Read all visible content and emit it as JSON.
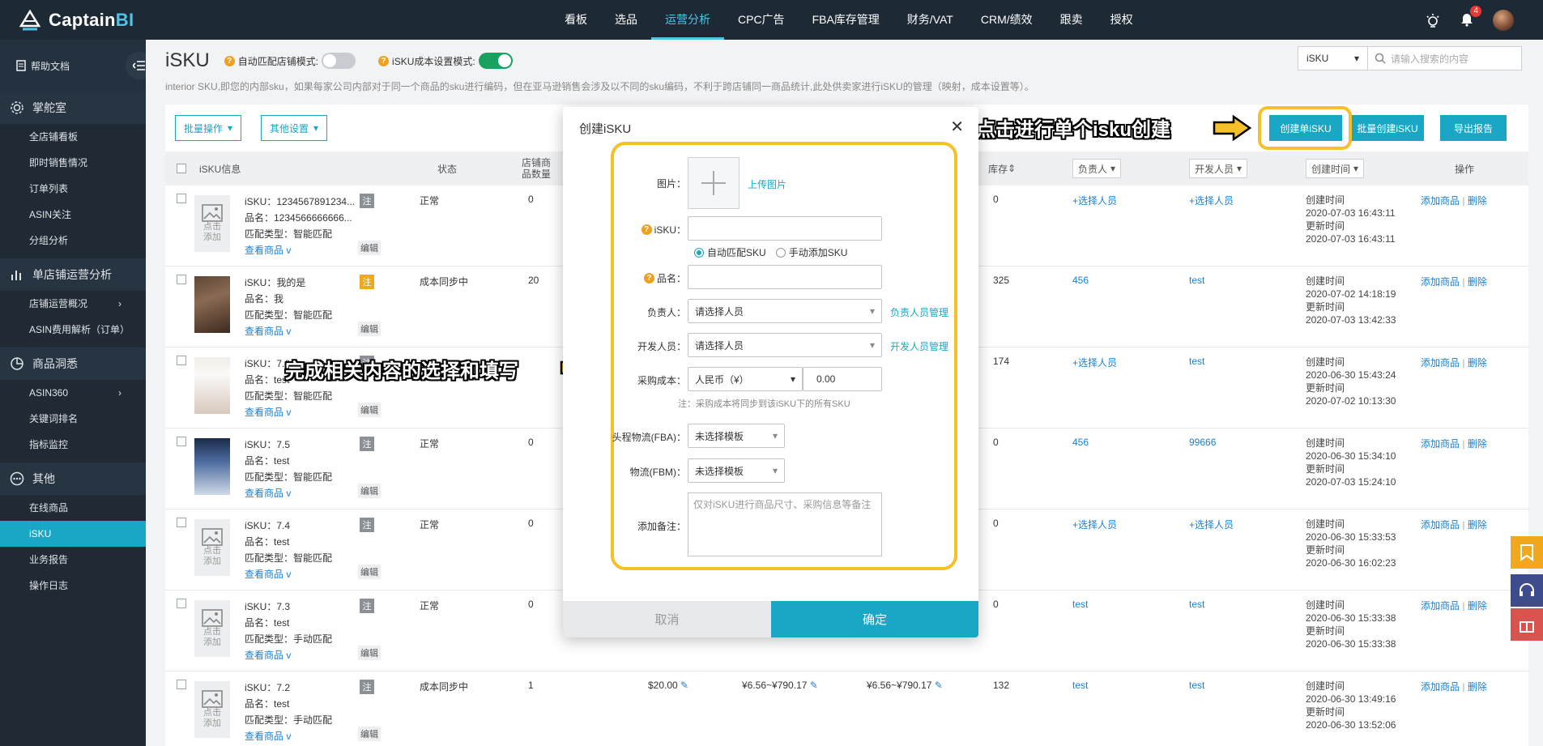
{
  "app": {
    "logo_main": "Captain",
    "logo_accent": "BI"
  },
  "nav": [
    "看板",
    "选品",
    "运营分析",
    "CPC广告",
    "FBA库存管理",
    "财务/VAT",
    "CRM/绩效",
    "跟卖",
    "授权"
  ],
  "nav_active": "运营分析",
  "notifications": "4",
  "sidebar": {
    "help": "帮助文档",
    "sections": [
      {
        "title": "掌舵室",
        "icon": "gear-icon",
        "items": [
          "全店铺看板",
          "即时销售情况",
          "订单列表",
          "ASIN关注",
          "分组分析"
        ]
      },
      {
        "title": "单店铺运营分析",
        "icon": "bar-chart-icon",
        "items": [
          "店铺运营概况",
          "ASIN费用解析（订单）"
        ]
      },
      {
        "title": "商品洞悉",
        "icon": "pie-icon",
        "items": [
          "ASIN360",
          "关键词排名",
          "指标监控"
        ]
      },
      {
        "title": "其他",
        "icon": "more-icon",
        "items": [
          "在线商品",
          "iSKU",
          "业务报告",
          "操作日志"
        ]
      }
    ],
    "active_item": "iSKU"
  },
  "page": {
    "title": "iSKU",
    "mode1_label": "自动匹配店铺模式:",
    "mode2_label": "iSKU成本设置模式:",
    "description": "interior SKU,即您的内部sku，如果每家公司内部对于同一个商品的sku进行编码，但在亚马逊销售会涉及以不同的sku编码，不利于跨店铺同一商品统计,此处供卖家进行iSKU的管理（映射，成本设置等）。",
    "search_select": "iSKU",
    "search_placeholder": "请输入搜索的内容"
  },
  "toolbar": {
    "batch_ops": "批量操作",
    "other_settings": "其他设置",
    "create_single": "创建单iSKU",
    "create_batch": "批量创建iSKU",
    "export": "导出报告"
  },
  "table_headers": {
    "info": "iSKU信息",
    "status": "状态",
    "shop_count_1": "店铺商",
    "shop_count_2": "品数量",
    "stock": "库存",
    "owner": "负责人",
    "developer": "开发人员",
    "created": "创建时间",
    "action": "操作"
  },
  "rows": [
    {
      "isku": "iSKU：1234567891234...",
      "name": "品名：1234566666666...",
      "match": "匹配类型：智能匹配",
      "view": "查看商品 v",
      "tag": "注",
      "status": "正常",
      "count": "0",
      "price": "",
      "cost1": "",
      "cost2": "",
      "stock": "0",
      "owner": "+选择人员",
      "dev": "+选择人员",
      "created_label": "创建时间",
      "created": "2020-07-03 16:43:11",
      "updated_label": "更新时间",
      "updated": "2020-07-03 16:43:11",
      "placeholder": "点击添加",
      "edit": "编辑"
    },
    {
      "isku": "iSKU：我的是",
      "name": "品名：我",
      "match": "匹配类型：智能匹配",
      "view": "查看商品 v",
      "tag": "注",
      "status": "成本同步中",
      "count": "20",
      "price": "",
      "cost1": "",
      "cost2": "",
      "stock": "325",
      "owner": "456",
      "dev": "test",
      "created_label": "创建时间",
      "created": "2020-07-02 14:18:19",
      "updated_label": "更新时间",
      "updated": "2020-07-03 13:42:33",
      "placeholder": "",
      "edit": "编辑"
    },
    {
      "isku": "iSKU：7.6",
      "name": "品名：test",
      "match": "匹配类型：智能匹配",
      "view": "查看商品 v",
      "tag": "注",
      "status": "",
      "count": "",
      "price": "",
      "cost1": "",
      "cost2": "",
      "stock": "174",
      "owner": "+选择人员",
      "dev": "test",
      "created_label": "创建时间",
      "created": "2020-06-30 15:43:24",
      "updated_label": "更新时间",
      "updated": "2020-07-02 10:13:30",
      "placeholder": "",
      "edit": "编辑"
    },
    {
      "isku": "iSKU：7.5",
      "name": "品名：test",
      "match": "匹配类型：智能匹配",
      "view": "查看商品 v",
      "tag": "注",
      "status": "正常",
      "count": "0",
      "price": "",
      "cost1": "",
      "cost2": "",
      "stock": "0",
      "owner": "456",
      "dev": "99666",
      "created_label": "创建时间",
      "created": "2020-06-30 15:34:10",
      "updated_label": "更新时间",
      "updated": "2020-07-03 15:24:10",
      "placeholder": "",
      "edit": "编辑"
    },
    {
      "isku": "iSKU：7.4",
      "name": "品名：test",
      "match": "匹配类型：智能匹配",
      "view": "查看商品 v",
      "tag": "注",
      "status": "正常",
      "count": "0",
      "price": "",
      "cost1": "",
      "cost2": "",
      "stock": "0",
      "owner": "+选择人员",
      "dev": "+选择人员",
      "created_label": "创建时间",
      "created": "2020-06-30 15:33:53",
      "updated_label": "更新时间",
      "updated": "2020-06-30 16:02:23",
      "placeholder": "点击添加",
      "edit": "编辑"
    },
    {
      "isku": "iSKU：7.3",
      "name": "品名：test",
      "match": "匹配类型：手动匹配",
      "view": "查看商品 v",
      "tag": "注",
      "status": "正常",
      "count": "0",
      "price": "",
      "cost1": "",
      "cost2": "",
      "stock": "0",
      "owner": "test",
      "dev": "test",
      "created_label": "创建时间",
      "created": "2020-06-30 15:33:38",
      "updated_label": "更新时间",
      "updated": "2020-06-30 15:33:38",
      "placeholder": "点击添加",
      "edit": "编辑"
    },
    {
      "isku": "iSKU：7.2",
      "name": "品名：test",
      "match": "匹配类型：手动匹配",
      "view": "查看商品 v",
      "tag": "注",
      "status": "成本同步中",
      "count": "1",
      "price": "$20.00",
      "cost1": "¥6.56~¥790.17",
      "cost2": "¥6.56~¥790.17",
      "stock": "132",
      "owner": "test",
      "dev": "test",
      "created_label": "创建时间",
      "created": "2020-06-30 13:49:16",
      "updated_label": "更新时间",
      "updated": "2020-06-30 13:52:06",
      "placeholder": "点击添加",
      "edit": "编辑"
    }
  ],
  "row_actions": {
    "add": "添加商品",
    "sep": "|",
    "delete": "删除"
  },
  "modal": {
    "title": "创建iSKU",
    "image_label": "图片：",
    "upload": "上传图片",
    "isku_label": "iSKU：",
    "radio_auto": "自动匹配SKU",
    "radio_manual": "手动添加SKU",
    "name_label": "品名：",
    "owner_label": "负责人：",
    "owner_placeholder": "请选择人员",
    "owner_manage": "负责人员管理",
    "dev_label": "开发人员：",
    "dev_placeholder": "请选择人员",
    "dev_manage": "开发人员管理",
    "cost_label": "采购成本：",
    "currency": "人民币（¥）",
    "cost_value": "0.00",
    "cost_note": "注：采购成本将同步到该iSKU下的所有SKU",
    "fba_label": "头程物流(FBA)：",
    "fba_value": "未选择模板",
    "fbm_label": "物流(FBM)：",
    "fbm_value": "未选择模板",
    "remark_label": "添加备注：",
    "remark_placeholder": "仅对iSKU进行商品尺寸、采购信息等备注",
    "cancel": "取消",
    "confirm": "确定"
  },
  "annotations": {
    "right": "点击进行单个isku创建",
    "left": "完成相关内容的选择和填写",
    "color": "#f5c12b"
  },
  "colors": {
    "primary": "#1aa6c5",
    "topbar": "#1d2a35",
    "sidebar": "#1f2a35",
    "link": "#1a7fd1"
  }
}
